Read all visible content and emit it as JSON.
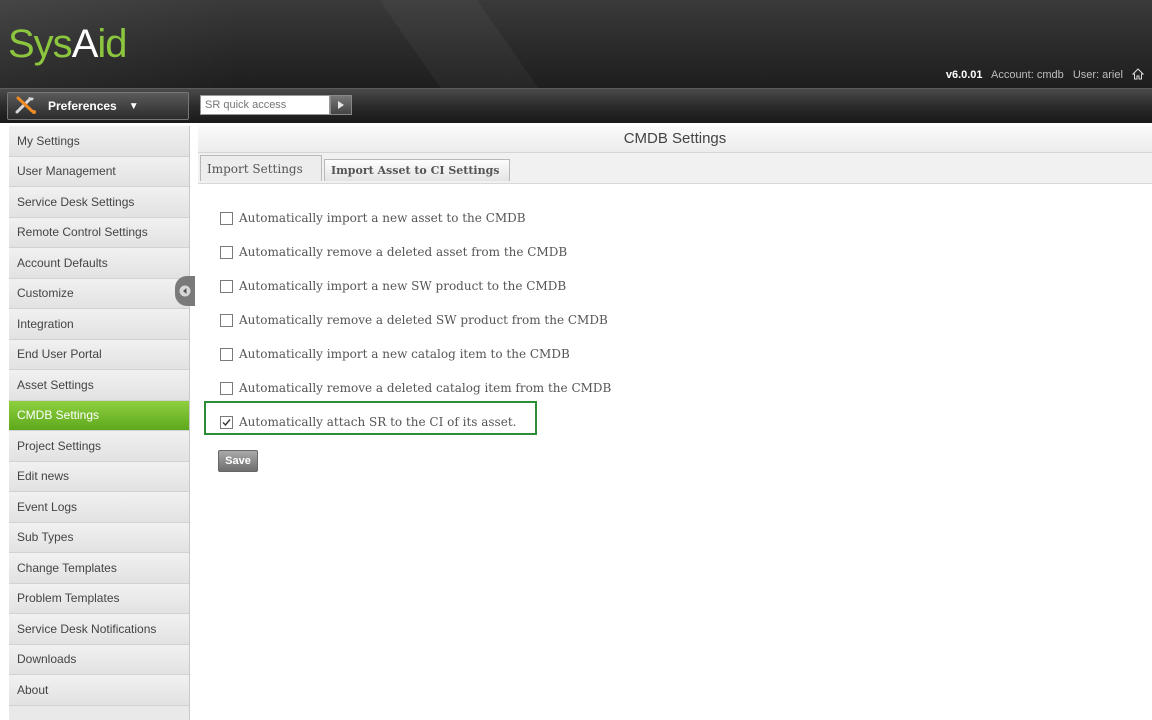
{
  "header": {
    "logo_prefix": "Sys",
    "logo_accent": "A",
    "logo_suffix": "id",
    "version": "v6.0.01",
    "account": "Account: cmdb",
    "user": "User: ariel"
  },
  "toolbar": {
    "preferences_label": "Preferences",
    "sr_quick_access_placeholder": "SR quick access"
  },
  "sidebar": {
    "items": [
      {
        "label": "My Settings",
        "active": false
      },
      {
        "label": "User Management",
        "active": false
      },
      {
        "label": "Service Desk Settings",
        "active": false
      },
      {
        "label": "Remote Control Settings",
        "active": false
      },
      {
        "label": "Account Defaults",
        "active": false
      },
      {
        "label": "Customize",
        "active": false
      },
      {
        "label": "Integration",
        "active": false
      },
      {
        "label": "End User Portal",
        "active": false
      },
      {
        "label": "Asset Settings",
        "active": false
      },
      {
        "label": "CMDB Settings",
        "active": true
      },
      {
        "label": "Project Settings",
        "active": false
      },
      {
        "label": "Edit news",
        "active": false
      },
      {
        "label": "Event Logs",
        "active": false
      },
      {
        "label": "Sub Types",
        "active": false
      },
      {
        "label": "Change Templates",
        "active": false
      },
      {
        "label": "Problem Templates",
        "active": false
      },
      {
        "label": "Service Desk Notifications",
        "active": false
      },
      {
        "label": "Downloads",
        "active": false
      },
      {
        "label": "About",
        "active": false
      }
    ]
  },
  "main": {
    "title": "CMDB Settings",
    "tabs": [
      {
        "label": "Import Settings",
        "active": true
      },
      {
        "label": "Import Asset to CI Settings",
        "active": false
      }
    ],
    "options": [
      {
        "label": "Automatically import a new asset to the CMDB",
        "checked": false
      },
      {
        "label": "Automatically remove a deleted asset from the CMDB",
        "checked": false
      },
      {
        "label": "Automatically import a new SW product to the CMDB",
        "checked": false
      },
      {
        "label": "Automatically remove a deleted SW product from the CMDB",
        "checked": false
      },
      {
        "label": "Automatically import a new catalog item to the CMDB",
        "checked": false
      },
      {
        "label": "Automatically remove a deleted catalog item from the CMDB",
        "checked": false
      },
      {
        "label": "Automatically attach SR to the CI of its asset.",
        "checked": true
      }
    ],
    "save_label": "Save"
  },
  "colors": {
    "brand_green": "#8cc63f",
    "active_item": "#6cb52a",
    "highlight_border": "#2e8b36"
  }
}
